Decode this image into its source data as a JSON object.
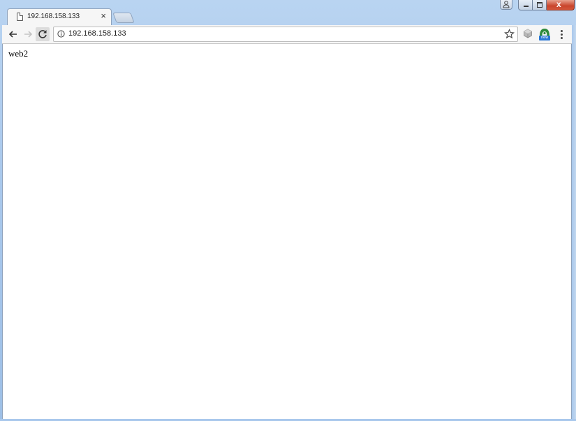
{
  "tab": {
    "title": "192.168.158.133",
    "close_glyph": "×",
    "icon": "page-icon"
  },
  "window_controls": {
    "close_glyph": "x"
  },
  "toolbar": {
    "back_icon": "arrow-left-icon",
    "forward_icon": "arrow-right-icon",
    "reload_icon": "reload-icon",
    "menu_icon": "kebab-menu-icon"
  },
  "omnibox": {
    "url": "192.168.158.133",
    "info_icon": "info-icon",
    "bookmark_icon": "star-icon"
  },
  "extensions": {
    "ext2_badge": "new"
  },
  "page": {
    "body_text": "web2"
  },
  "colors": {
    "frame": "#a9c8ec",
    "close_button": "#c9452c",
    "toolbar": "#f6f6f6"
  }
}
